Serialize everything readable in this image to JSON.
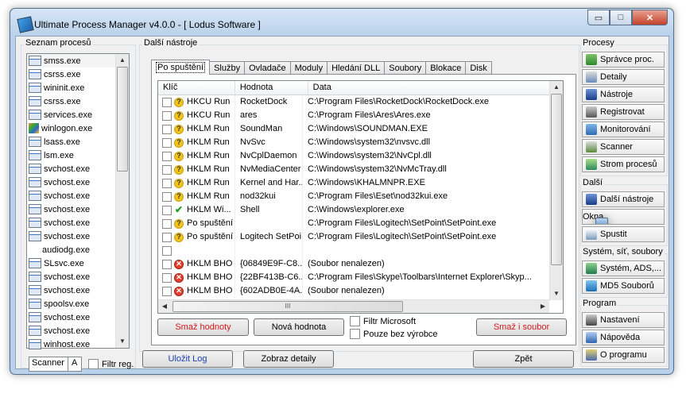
{
  "window": {
    "title": "Ultimate Process Manager v4.0.0 - [ Lodus Software ]",
    "min": "▭",
    "max": "□",
    "close": "✕"
  },
  "processes": {
    "label": "Seznam procesů",
    "items": [
      "smss.exe",
      "csrss.exe",
      "wininit.exe",
      "csrss.exe",
      "services.exe",
      "winlogon.exe",
      "lsass.exe",
      "lsm.exe",
      "svchost.exe",
      "svchost.exe",
      "svchost.exe",
      "svchost.exe",
      "svchost.exe",
      "svchost.exe",
      "audiodg.exe",
      "SLsvc.exe",
      "svchost.exe",
      "svchost.exe",
      "spoolsv.exe",
      "svchost.exe",
      "svchost.exe",
      "winhost.exe"
    ],
    "scanner_value": "Scanner",
    "scanner_btn": "A",
    "filter_label": "Filtr reg."
  },
  "tools": {
    "label": "Další nástroje",
    "tabs": [
      "Po spuštění",
      "Služby",
      "Ovladače",
      "Moduly",
      "Hledání DLL",
      "Soubory",
      "Blokace",
      "Disk"
    ],
    "columns": [
      "Klíč",
      "Hodnota",
      "Data"
    ],
    "rows": [
      {
        "status": "?",
        "key": "HKCU Run",
        "value": "RocketDock",
        "data": "C:\\Program Files\\RocketDock\\RocketDock.exe"
      },
      {
        "status": "?",
        "key": "HKCU Run",
        "value": "ares",
        "data": "C:\\Program Files\\Ares\\Ares.exe"
      },
      {
        "status": "?",
        "key": "HKLM Run",
        "value": "SoundMan",
        "data": "C:\\Windows\\SOUNDMAN.EXE"
      },
      {
        "status": "?",
        "key": "HKLM Run",
        "value": "NvSvc",
        "data": "C:\\Windows\\system32\\nvsvc.dll"
      },
      {
        "status": "?",
        "key": "HKLM Run",
        "value": "NvCplDaemon",
        "data": "C:\\Windows\\system32\\NvCpl.dll"
      },
      {
        "status": "?",
        "key": "HKLM Run",
        "value": "NvMediaCenter",
        "data": "C:\\Windows\\system32\\NvMcTray.dll"
      },
      {
        "status": "?",
        "key": "HKLM Run",
        "value": "Kernel and Har...",
        "data": "C:\\Windows\\KHALMNPR.EXE"
      },
      {
        "status": "?",
        "key": "HKLM Run",
        "value": "nod32kui",
        "data": "C:\\Program Files\\Eset\\nod32kui.exe"
      },
      {
        "status": "ok",
        "key": "HKLM Wi...",
        "value": "Shell",
        "data": "C:\\Windows\\explorer.exe"
      },
      {
        "status": "?",
        "key": "Po spuštění",
        "value": "",
        "data": "C:\\Program Files\\Logitech\\SetPoint\\SetPoint.exe"
      },
      {
        "status": "?",
        "key": "Po spuštění",
        "value": "Logitech SetPoi...",
        "data": "C:\\Program Files\\Logitech\\SetPoint\\SetPoint.exe"
      },
      {
        "status": "",
        "key": "",
        "value": "",
        "data": ""
      },
      {
        "status": "err",
        "key": "HKLM BHO",
        "value": "{06849E9F-C8...",
        "data": " (Soubor nenalezen)"
      },
      {
        "status": "err",
        "key": "HKLM BHO",
        "value": "{22BF413B-C6...",
        "data": "C:\\Program Files\\Skype\\Toolbars\\Internet Explorer\\Skyp..."
      },
      {
        "status": "err",
        "key": "HKLM BHO",
        "value": "{602ADB0E-4A...",
        "data": " (Soubor nenalezen)"
      }
    ],
    "hscroll_mark": "III",
    "btn_delete_values": "Smaž hodnoty",
    "btn_new_value": "Nová hodnota",
    "chk_filter_ms": "Filtr Microsoft",
    "chk_no_vendor": "Pouze bez výrobce",
    "btn_delete_file": "Smaž i soubor"
  },
  "bottom": {
    "save_log": "Uložit Log",
    "show_details": "Zobraz detaily",
    "back": "Zpět"
  },
  "sidebar": {
    "groups": [
      {
        "label": "Procesy",
        "items": [
          {
            "label": "Správce proc.",
            "icon": "proc"
          },
          {
            "label": "Detaily",
            "icon": "det"
          },
          {
            "label": "Nástroje",
            "icon": "tool"
          },
          {
            "label": "Registrovat",
            "icon": "reg"
          },
          {
            "label": "Monitorování",
            "icon": "mon"
          },
          {
            "label": "Scanner",
            "icon": "scan"
          },
          {
            "label": "Strom procesů",
            "icon": "tree"
          }
        ]
      },
      {
        "label": "Další",
        "items": [
          {
            "label": "Další nástroje",
            "icon": "tool"
          },
          {
            "label": "Okna",
            "icon": "win"
          },
          {
            "label": "Spustit",
            "icon": "run"
          }
        ]
      },
      {
        "label": "Systém, síť, soubory",
        "items": [
          {
            "label": "Systém, ADS,...",
            "icon": "net"
          },
          {
            "label": "MD5 Souborů",
            "icon": "md5"
          }
        ]
      },
      {
        "label": "Program",
        "items": [
          {
            "label": "Nastavení",
            "icon": "set"
          },
          {
            "label": "Nápověda",
            "icon": "help"
          },
          {
            "label": "O programu",
            "icon": "about"
          }
        ]
      }
    ]
  }
}
